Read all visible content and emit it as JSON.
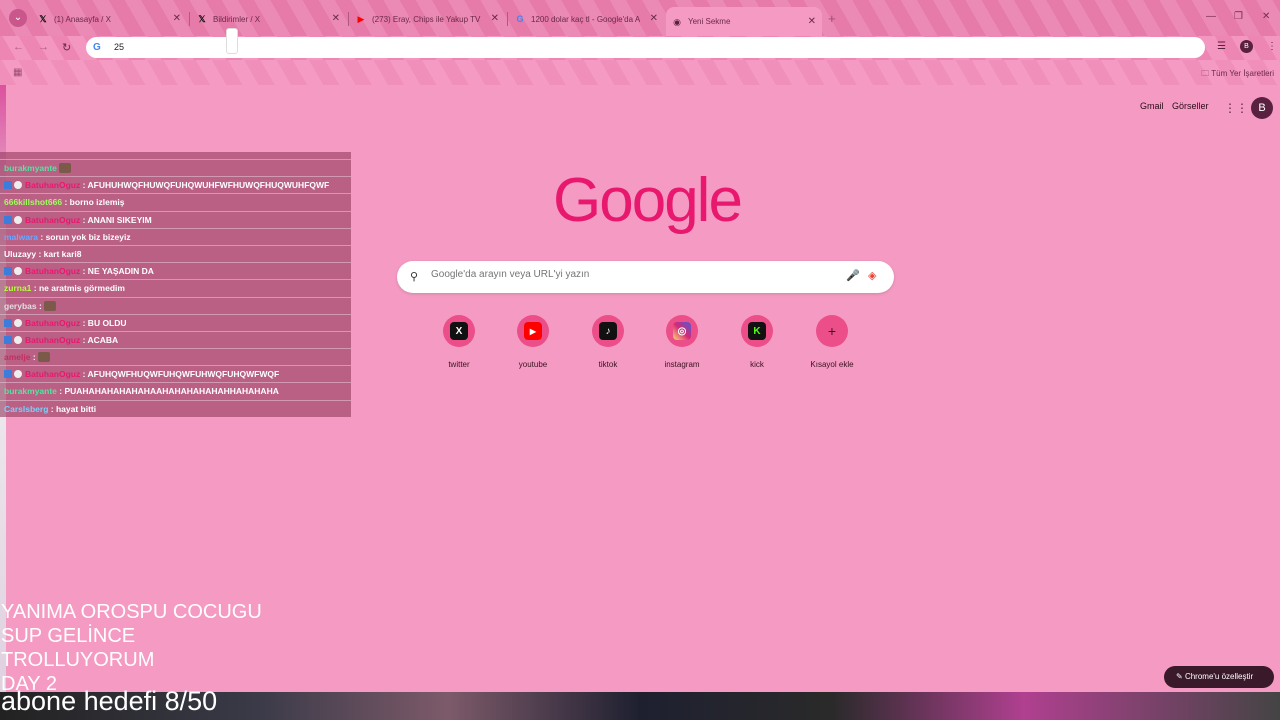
{
  "browser": {
    "tabs": [
      {
        "title": "(1) Anasayfa / X",
        "favicon": "x-icon"
      },
      {
        "title": "Bildirimler / X",
        "favicon": "x-icon"
      },
      {
        "title": "(273) Eray, Chips ile Yakup TV",
        "favicon": "youtube-icon"
      },
      {
        "title": "1200 dolar kaç tl - Google'da A",
        "favicon": "google-icon"
      },
      {
        "title": "Yeni Sekme",
        "favicon": "chrome-icon"
      }
    ],
    "omnibox_value": "25",
    "bookmarks_all": "Tüm Yer İşaretleri"
  },
  "google": {
    "links": {
      "gmail": "Gmail",
      "images": "Görseller"
    },
    "avatar_letter": "B",
    "logo": "Google",
    "search_placeholder": "Google'da arayın veya URL'yi yazın",
    "shortcuts": [
      {
        "label": "twitter",
        "glyph": "X",
        "color": "#111111"
      },
      {
        "label": "youtube",
        "glyph": "▶",
        "color": "#ff0000"
      },
      {
        "label": "tiktok",
        "glyph": "♪",
        "color": "#111111"
      },
      {
        "label": "instagram",
        "glyph": "◎",
        "color": "#d62976"
      },
      {
        "label": "kick",
        "glyph": "K",
        "color": "#111111"
      },
      {
        "label": "Kısayol ekle",
        "glyph": "+",
        "color": "transparent"
      }
    ],
    "customize_label": "Chrome'u özelleştir"
  },
  "chat": [
    {
      "user": "burakmyante",
      "msg": "",
      "color": "#56e39f",
      "badges": false,
      "emote": true
    },
    {
      "user": "BatuhanOguz",
      "msg": ": AFUHUHWQFHUWQFUHQWUHFWFHUWQFHUQWUHFQWF",
      "color": "#e8186f",
      "badges": true,
      "emote": false
    },
    {
      "user": "666killshot666",
      "msg": ": borno izlemiş",
      "color": "#9dff5c",
      "badges": false,
      "emote": false
    },
    {
      "user": "BatuhanOguz",
      "msg": ": ANANI SIKEYIM",
      "color": "#e8186f",
      "badges": true,
      "emote": false
    },
    {
      "user": "malwara",
      "msg": ": sorun yok biz bizeyiz",
      "color": "#6aa8ff",
      "badges": false,
      "emote": false
    },
    {
      "user": "Uluzayy",
      "msg": ": kart kari8",
      "color": "#ffffff",
      "badges": false,
      "emote": false
    },
    {
      "user": "BatuhanOguz",
      "msg": ": NE YAŞADIN DA",
      "color": "#e8186f",
      "badges": true,
      "emote": false
    },
    {
      "user": "zurna1",
      "msg": ": ne aratmis görmedim",
      "color": "#b6ff3a",
      "badges": false,
      "emote": false
    },
    {
      "user": "gerybas",
      "msg": ":",
      "color": "#e0e0e0",
      "badges": false,
      "emote": true
    },
    {
      "user": "BatuhanOguz",
      "msg": ": BU OLDU",
      "color": "#e8186f",
      "badges": true,
      "emote": false
    },
    {
      "user": "BatuhanOguz",
      "msg": ": ACABA",
      "color": "#e8186f",
      "badges": true,
      "emote": false
    },
    {
      "user": "amelje",
      "msg": ":",
      "color": "#c03060",
      "badges": false,
      "emote": true
    },
    {
      "user": "BatuhanOguz",
      "msg": ": AFUHQWFHUQWFUHQWFUHWQFUHQWFWQF",
      "color": "#e8186f",
      "badges": true,
      "emote": false
    },
    {
      "user": "burakmyante",
      "msg": ": PUAHAHAHAHAHAHAAHAHAHAHAHAHHAHAHAHA",
      "color": "#56e39f",
      "badges": false,
      "emote": false
    },
    {
      "user": "Carslsberg",
      "msg": ": hayat bitti",
      "color": "#7ad0ff",
      "badges": false,
      "emote": false
    }
  ],
  "overlay": {
    "lines": [
      "YANIMA OROSPU COCUGU",
      "SUP GELİNCE",
      "TROLLUYORUM",
      "DAY 2"
    ],
    "goal": "abone hedefi 8/50"
  }
}
